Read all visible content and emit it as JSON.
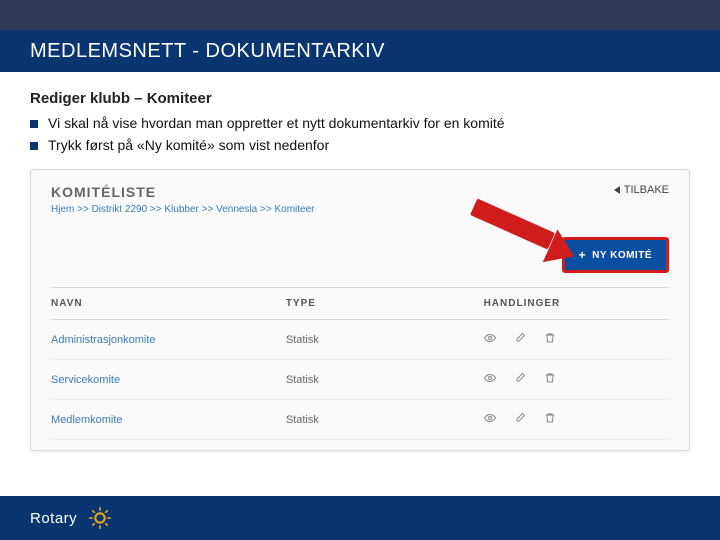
{
  "header": {
    "title": "MEDLEMSNETT - DOKUMENTARKIV"
  },
  "subtitle": "Rediger klubb – Komiteer",
  "bullets": [
    "Vi skal nå vise hvordan man oppretter et nytt dokumentarkiv for en komité",
    "Trykk først på «Ny komité» som vist nedenfor"
  ],
  "panel": {
    "title": "KOMITÉLISTE",
    "back": "TILBAKE",
    "breadcrumb": "Hjem >> Distrikt 2290 >> Klubber >> Vennesla >> Komiteer",
    "newButton": "NY KOMITÉ",
    "cols": {
      "name": "NAVN",
      "type": "TYPE",
      "actions": "HANDLINGER"
    },
    "rows": [
      {
        "name": "Administrasjonkomite",
        "type": "Statisk"
      },
      {
        "name": "Servicekomite",
        "type": "Statisk"
      },
      {
        "name": "Medlemkomite",
        "type": "Statisk"
      }
    ]
  },
  "footer": {
    "brand": "Rotary"
  }
}
